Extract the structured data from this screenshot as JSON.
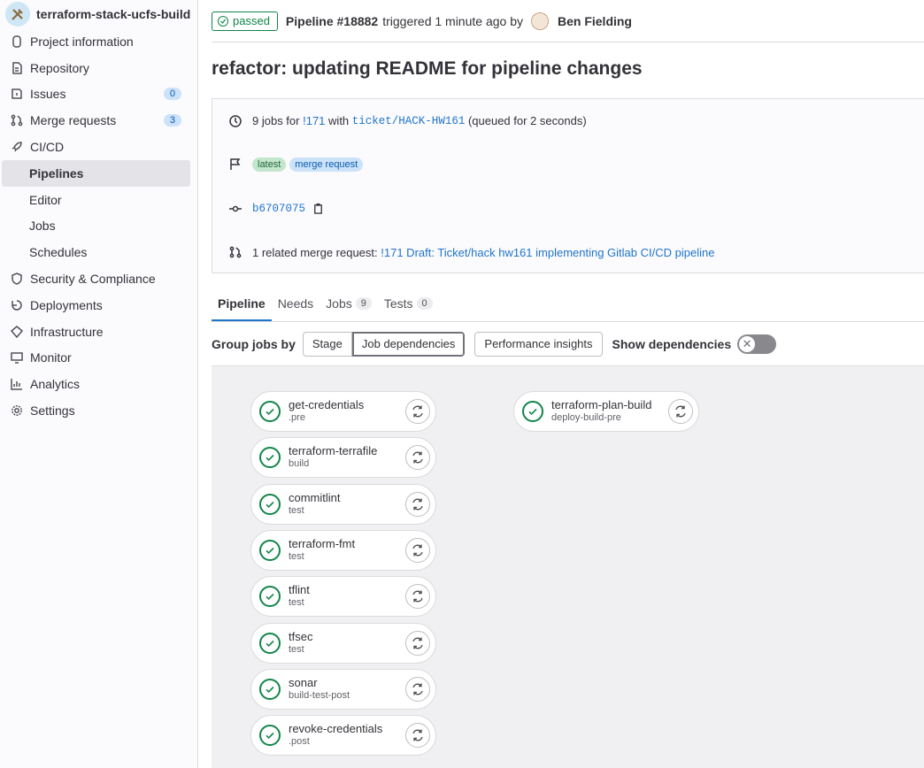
{
  "sidebar": {
    "project_name": "terraform-stack-ucfs-build",
    "items": [
      {
        "label": "Project information",
        "icon": "project-icon"
      },
      {
        "label": "Repository",
        "icon": "doc-icon"
      },
      {
        "label": "Issues",
        "icon": "issues-icon",
        "count": "0"
      },
      {
        "label": "Merge requests",
        "icon": "merge-request-icon",
        "count": "3"
      },
      {
        "label": "CI/CD",
        "icon": "rocket-icon"
      }
    ],
    "cicd_sub": [
      "Pipelines",
      "Editor",
      "Jobs",
      "Schedules"
    ],
    "items_after": [
      {
        "label": "Security & Compliance",
        "icon": "shield-icon"
      },
      {
        "label": "Deployments",
        "icon": "deployments-icon"
      },
      {
        "label": "Infrastructure",
        "icon": "cloud-icon"
      },
      {
        "label": "Monitor",
        "icon": "monitor-icon"
      },
      {
        "label": "Analytics",
        "icon": "chart-icon"
      },
      {
        "label": "Settings",
        "icon": "gear-icon"
      }
    ]
  },
  "header": {
    "status": "passed",
    "pipeline": "Pipeline #18882",
    "triggered": "triggered 1 minute ago by",
    "user": "Ben Fielding"
  },
  "title": "refactor: updating README for pipeline changes",
  "info": {
    "jobs_text": "9 jobs for",
    "mr_ref": "!171",
    "with": "with",
    "branch": "ticket/HACK-HW161",
    "queued": "(queued for 2 seconds)",
    "tags": [
      "latest",
      "merge request"
    ],
    "commit": "b6707075",
    "related_text": "1 related merge request:",
    "related_link": "!171 Draft: Ticket/hack hw161 implementing Gitlab CI/CD pipeline"
  },
  "tabs": [
    {
      "label": "Pipeline"
    },
    {
      "label": "Needs"
    },
    {
      "label": "Jobs",
      "count": "9"
    },
    {
      "label": "Tests",
      "count": "0"
    }
  ],
  "controls": {
    "group_by": "Group jobs by",
    "stage": "Stage",
    "job_deps": "Job dependencies",
    "perf": "Performance insights",
    "show_deps": "Show dependencies",
    "show_deps_on": false
  },
  "jobs": [
    {
      "name": "get-credentials",
      "stage": ".pre"
    },
    {
      "name": "terraform-terrafile",
      "stage": "build"
    },
    {
      "name": "commitlint",
      "stage": "test"
    },
    {
      "name": "terraform-fmt",
      "stage": "test"
    },
    {
      "name": "tflint",
      "stage": "test"
    },
    {
      "name": "tfsec",
      "stage": "test"
    },
    {
      "name": "sonar",
      "stage": "build-test-post"
    },
    {
      "name": "revoke-credentials",
      "stage": ".post"
    },
    {
      "name": "terraform-plan-build",
      "stage": "deploy-build-pre"
    }
  ],
  "colors": {
    "success": "#108548",
    "link": "#1f75cb"
  }
}
